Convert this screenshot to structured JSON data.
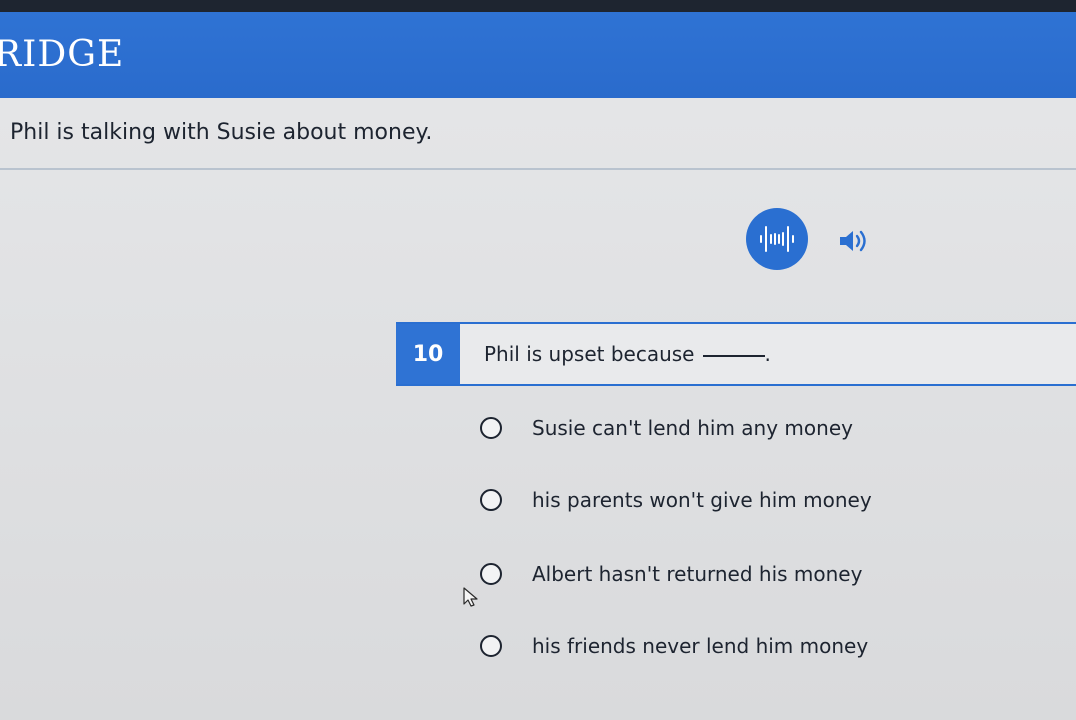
{
  "header": {
    "brand": "RIDGE",
    "color": "#2f73d4"
  },
  "prompt": {
    "text": "Phil is talking with Susie about money."
  },
  "audio": {
    "play_icon": "waveform-icon",
    "volume_icon": "speaker-icon"
  },
  "question": {
    "number": "10",
    "text": "Phil is upset because",
    "end_punct": "."
  },
  "options": [
    {
      "label": "Susie can't lend him any money"
    },
    {
      "label": "his parents won't give him money"
    },
    {
      "label": "Albert hasn't returned his money"
    },
    {
      "label": "his friends never lend him money"
    }
  ]
}
